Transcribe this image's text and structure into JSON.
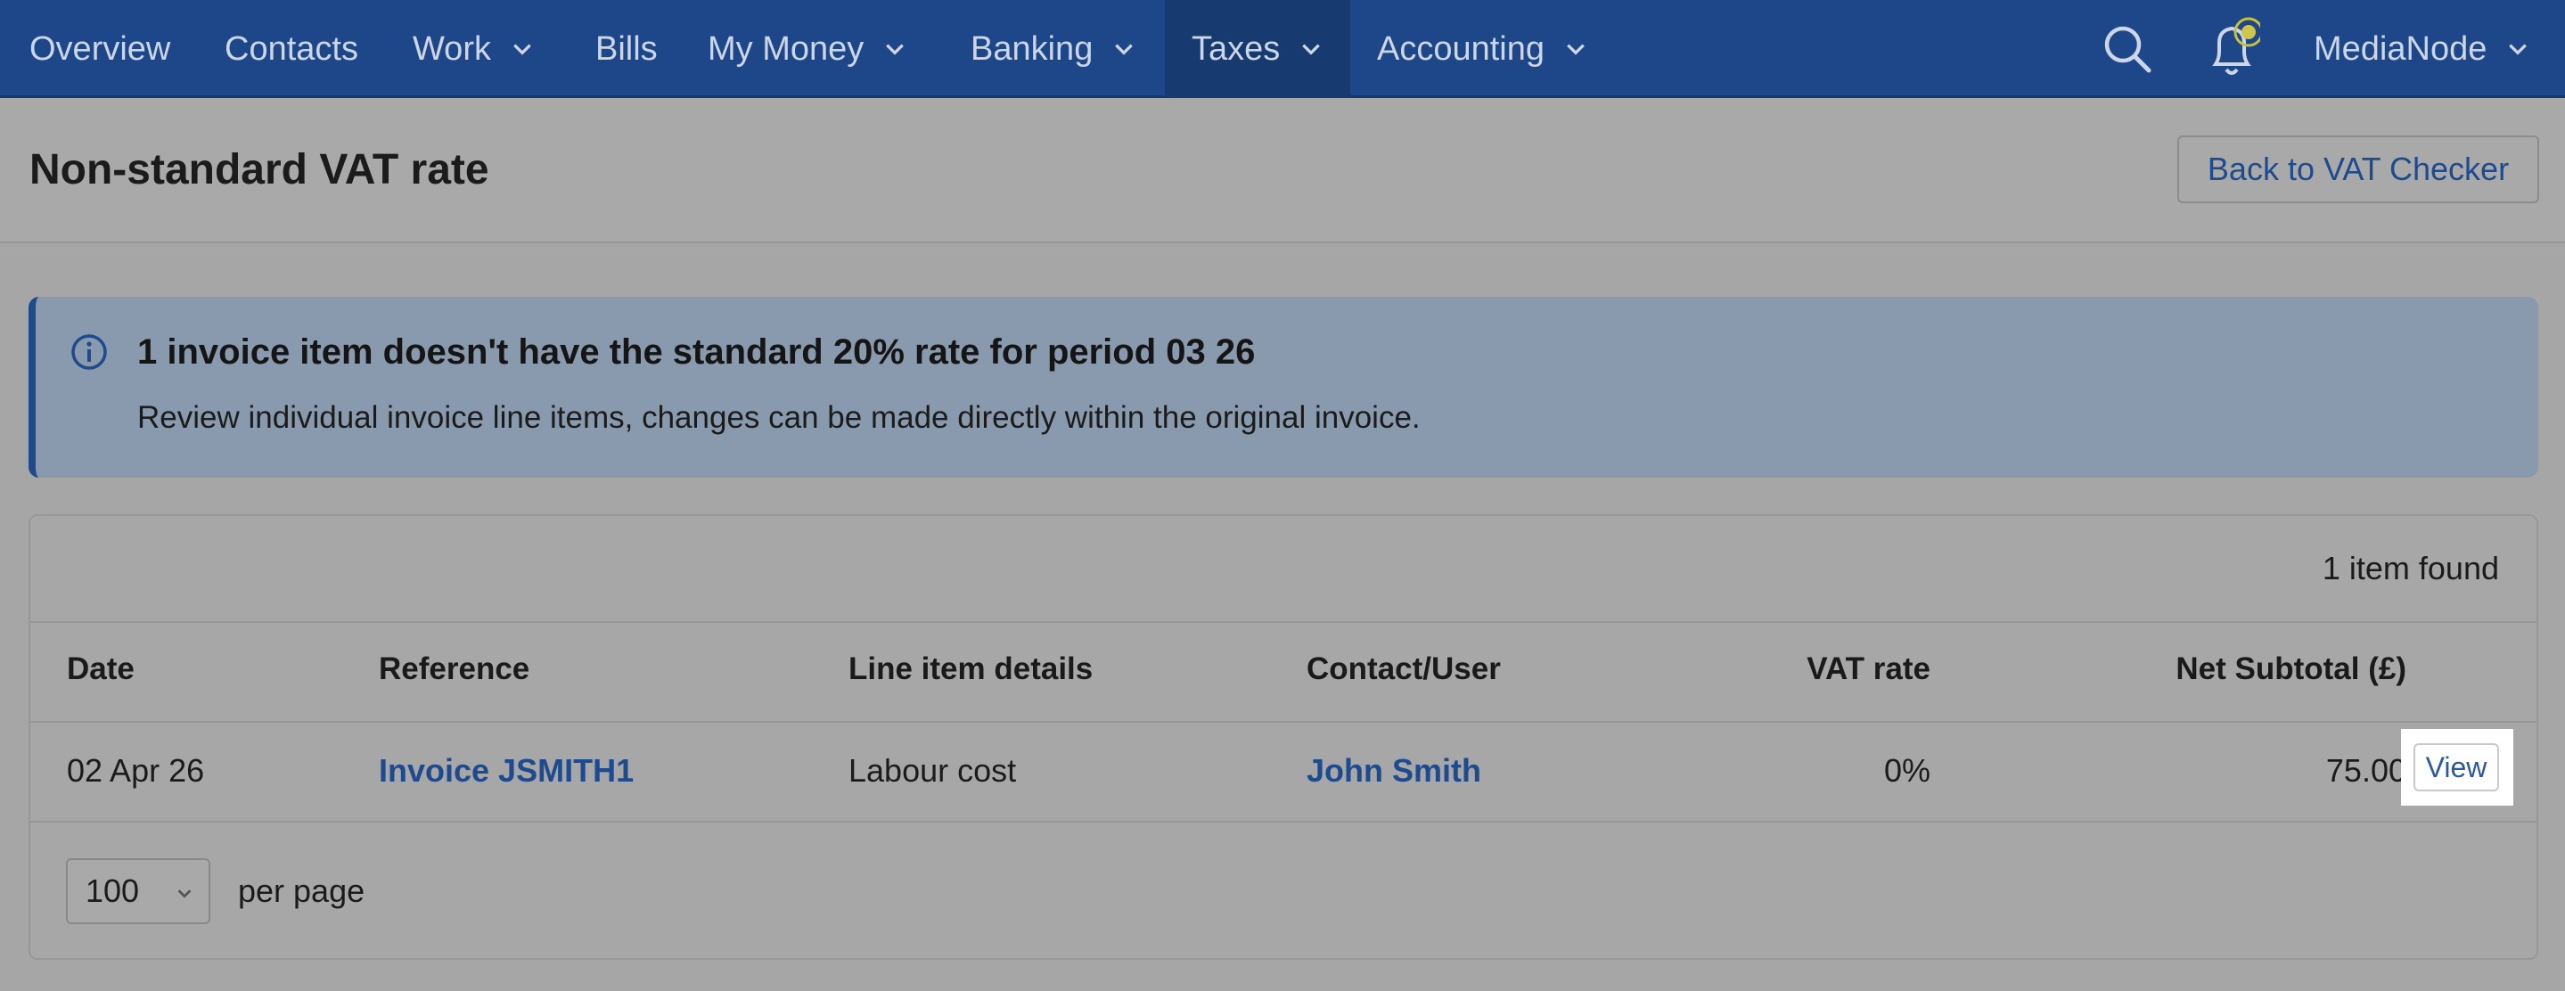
{
  "nav": {
    "items": [
      {
        "label": "Overview",
        "has_dropdown": false,
        "active": false
      },
      {
        "label": "Contacts",
        "has_dropdown": false,
        "active": false
      },
      {
        "label": "Work",
        "has_dropdown": true,
        "active": false
      },
      {
        "label": "Bills",
        "has_dropdown": false,
        "active": false
      },
      {
        "label": "My Money",
        "has_dropdown": true,
        "active": false
      },
      {
        "label": "Banking",
        "has_dropdown": true,
        "active": false
      },
      {
        "label": "Taxes",
        "has_dropdown": true,
        "active": true
      },
      {
        "label": "Accounting",
        "has_dropdown": true,
        "active": false
      }
    ],
    "icons": [
      "search-icon",
      "bell-icon"
    ],
    "user": "MediaNode"
  },
  "header": {
    "title": "Non-standard VAT rate",
    "back_button": "Back to VAT Checker"
  },
  "banner": {
    "icon": "info-icon",
    "title": "1 invoice item doesn't have the standard 20% rate for period 03 26",
    "text": "Review individual invoice line items, changes can be made directly within the original invoice."
  },
  "table": {
    "found": "1 item found",
    "columns": [
      "Date",
      "Reference",
      "Line item details",
      "Contact/User",
      "VAT rate",
      "Net Subtotal (£)"
    ],
    "rows": [
      {
        "date": "02 Apr 26",
        "reference": "Invoice JSMITH1",
        "details": "Labour cost",
        "contact": "John Smith",
        "vat_rate": "0%",
        "net_subtotal": "75.00",
        "action": "View"
      }
    ]
  },
  "pagination": {
    "per_page_value": "100",
    "per_page_label": "per page"
  },
  "colors": {
    "nav_bg": "#1d4788",
    "link": "#1e4b8f",
    "banner_bg": "#8a9aae"
  }
}
